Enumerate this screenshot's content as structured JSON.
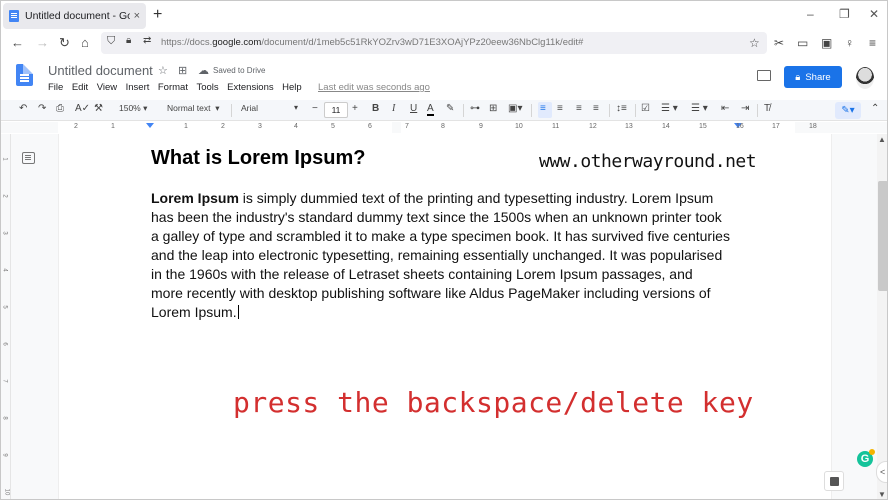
{
  "browser": {
    "tab_title": "Untitled document - Google Docs",
    "new_tab": "+",
    "tab_close": "×",
    "window_controls": {
      "minimize": "–",
      "restore": "❐",
      "close": "✕"
    },
    "nav": {
      "back": "←",
      "forward": "→",
      "reload": "↻",
      "home": "⌂"
    },
    "url_prefix": "https://docs.",
    "url_domain": "google.com",
    "url_path": "/document/d/1meb5c51RkYOZrv3wD71E3XOAjYPz20eew36NbClg11k/edit#",
    "icons": [
      "shield-icon",
      "lock-icon",
      "permissions-icon",
      "star-icon",
      "extension-icon",
      "collections-icon",
      "reader-icon",
      "account-icon",
      "menu-icon"
    ]
  },
  "docs_header": {
    "title": "Untitled document",
    "saved_status": "Saved to Drive",
    "menu": [
      "File",
      "Edit",
      "View",
      "Insert",
      "Format",
      "Tools",
      "Extensions",
      "Help"
    ],
    "last_edit": "Last edit was seconds ago",
    "share_label": "Share"
  },
  "toolbar": {
    "zoom": "150%",
    "style": "Normal text",
    "font": "Arial",
    "font_size": "11",
    "minus": "−",
    "plus": "+",
    "bold": "B",
    "italic": "I",
    "underline": "U",
    "text_color": "A"
  },
  "ruler": {
    "ticks": [
      "2",
      "1",
      "1",
      "2",
      "3",
      "4",
      "5",
      "6",
      "7",
      "8",
      "9",
      "10",
      "11",
      "12",
      "13",
      "14",
      "15",
      "16",
      "17",
      "18"
    ],
    "vticks": [
      "1",
      "2",
      "3",
      "4",
      "5",
      "6",
      "7",
      "8",
      "9",
      "10"
    ]
  },
  "document": {
    "heading": "What is Lorem Ipsum?",
    "watermark": "www.otherwayround.net",
    "bold_lead": "Lorem Ipsum",
    "lines": [
      " is simply dummied text of the printing and typesetting industry. Lorem Ipsum",
      "has been the industry's standard dummy text since the 1500s when an unknown printer took",
      "a galley of type and scrambled it to make a type specimen book. It has survived five centuries",
      "and the leap into electronic typesetting, remaining essentially unchanged. It was popularised",
      "in the 1960s with the release of Letraset sheets containing Lorem Ipsum passages, and",
      "more recently with desktop publishing software like Aldus PageMaker including versions of",
      "Lorem Ipsum."
    ],
    "annotation": "press the backspace/delete key"
  },
  "widgets": {
    "grammarly": "G",
    "side_toggle": "<"
  },
  "colors": {
    "accent": "#1a73e8",
    "annotation": "#d32f2f",
    "grammarly": "#15c39a"
  }
}
